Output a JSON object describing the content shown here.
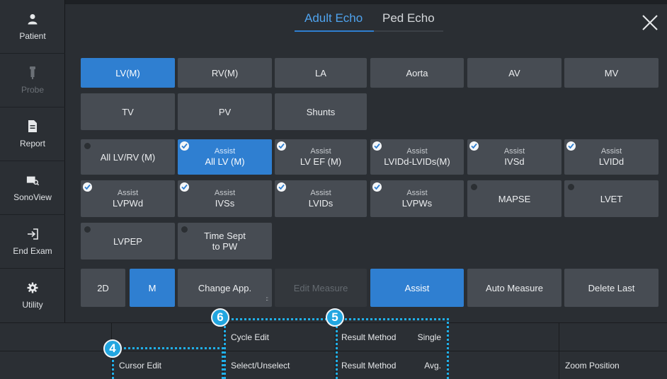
{
  "sidebar": {
    "items": [
      {
        "label": "Patient",
        "icon": "person-icon",
        "enabled": true
      },
      {
        "label": "Probe",
        "icon": "probe-icon",
        "enabled": false
      },
      {
        "label": "Report",
        "icon": "document-icon",
        "enabled": true
      },
      {
        "label": "SonoView",
        "icon": "sonoview-icon",
        "enabled": true
      },
      {
        "label": "End Exam",
        "icon": "exit-icon",
        "enabled": true
      },
      {
        "label": "Utility",
        "icon": "gear-icon",
        "enabled": true
      }
    ]
  },
  "tabs": {
    "adult": "Adult Echo",
    "ped": "Ped Echo",
    "active": "adult"
  },
  "categories": [
    "LV(M)",
    "RV(M)",
    "LA",
    "Aorta",
    "AV",
    "MV",
    "TV",
    "PV",
    "Shunts"
  ],
  "measures": [
    {
      "label": "All LV/RV (M)",
      "assist": "",
      "checked": false
    },
    {
      "label": "All LV (M)",
      "assist": "Assist",
      "checked": true
    },
    {
      "label": "LV EF (M)",
      "assist": "Assist",
      "checked": true
    },
    {
      "label": "LVIDd-LVIDs(M)",
      "assist": "Assist",
      "checked": true
    },
    {
      "label": "IVSd",
      "assist": "Assist",
      "checked": true
    },
    {
      "label": "LVIDd",
      "assist": "Assist",
      "checked": true
    },
    {
      "label": "LVPWd",
      "assist": "Assist",
      "checked": true
    },
    {
      "label": "IVSs",
      "assist": "Assist",
      "checked": true
    },
    {
      "label": "LVIDs",
      "assist": "Assist",
      "checked": true
    },
    {
      "label": "LVPWs",
      "assist": "Assist",
      "checked": true
    },
    {
      "label": "MAPSE",
      "assist": "",
      "checked": false
    },
    {
      "label": "LVET",
      "assist": "",
      "checked": false
    },
    {
      "label": "LVPEP",
      "assist": "",
      "checked": false
    },
    {
      "label": "Time Sept to PW",
      "assist": "",
      "checked": false
    }
  ],
  "toolbar": {
    "mode_2d": "2D",
    "mode_m": "M",
    "change_app": "Change App.",
    "edit_measure": "Edit Measure",
    "assist": "Assist",
    "auto_measure": "Auto Measure",
    "delete_last": "Delete Last"
  },
  "bottom": {
    "cycle_edit": "Cycle Edit",
    "cursor_edit": "Cursor Edit",
    "select_unselect": "Select/Unselect",
    "result_method_1": "Result Method",
    "result_value_1": "Single",
    "result_method_2": "Result Method",
    "result_value_2": "Avg.",
    "zoom_position": "Zoom Position"
  },
  "callouts": {
    "four": "4",
    "five": "5",
    "six": "6"
  },
  "colors": {
    "accent": "#2f7fd1",
    "callout": "#22a6e0",
    "button": "#474c53",
    "panel": "#2a2e33"
  }
}
